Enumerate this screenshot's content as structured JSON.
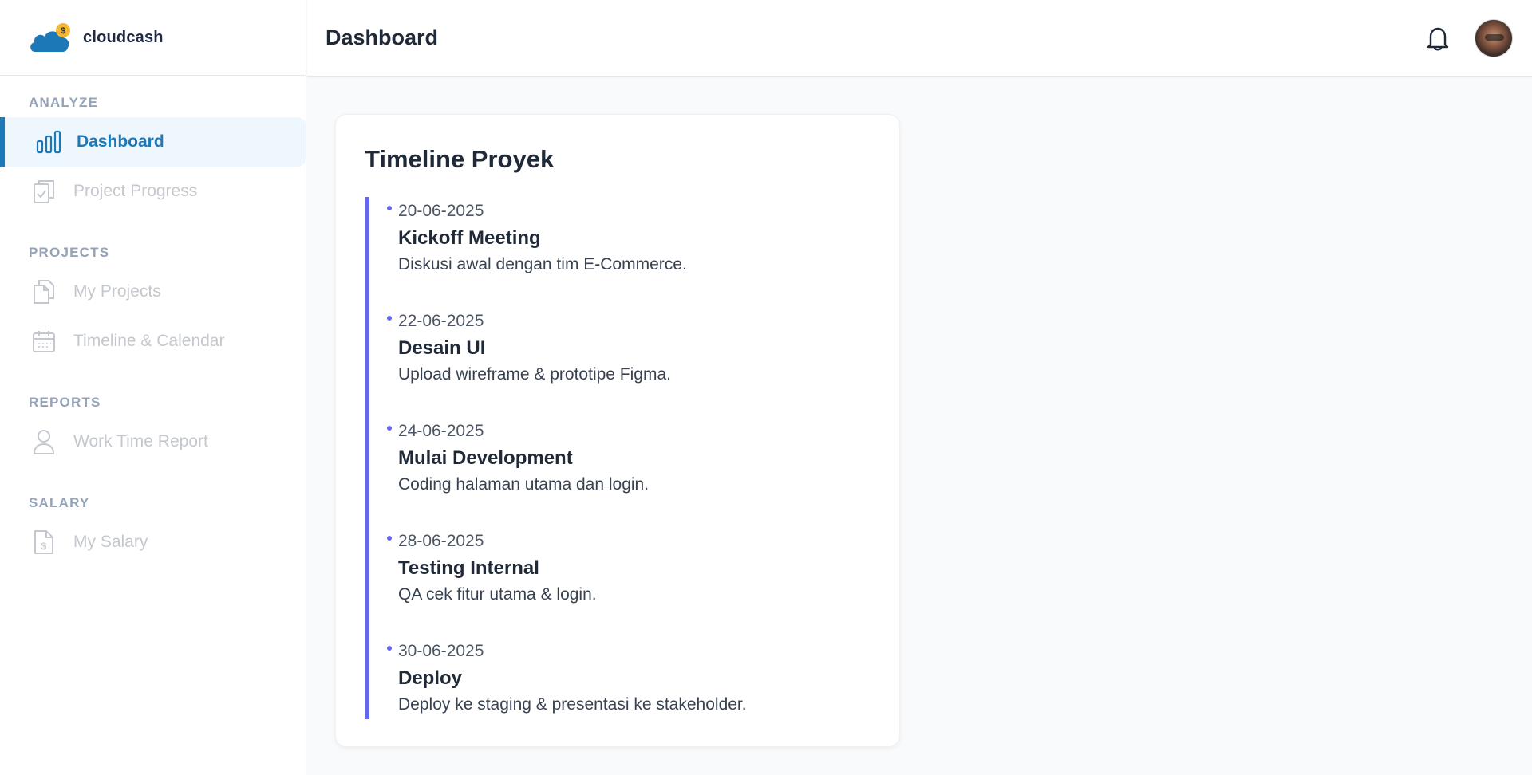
{
  "brand": {
    "name": "cloudcash"
  },
  "header": {
    "title": "Dashboard"
  },
  "sidebar": {
    "sections": [
      {
        "label": "ANALYZE"
      },
      {
        "label": "PROJECTS"
      },
      {
        "label": "REPORTS"
      },
      {
        "label": "SALARY"
      }
    ],
    "items": [
      {
        "label": "Dashboard",
        "icon": "bar-chart-icon",
        "active": true
      },
      {
        "label": "Project Progress",
        "icon": "clipboard-check-icon"
      },
      {
        "label": "My Projects",
        "icon": "documents-icon"
      },
      {
        "label": "Timeline & Calendar",
        "icon": "calendar-icon"
      },
      {
        "label": "Work Time Report",
        "icon": "user-icon"
      },
      {
        "label": "My Salary",
        "icon": "salary-document-icon"
      }
    ]
  },
  "card": {
    "title": "Timeline Proyek",
    "events": [
      {
        "date": "20-06-2025",
        "title": "Kickoff Meeting",
        "desc": "Diskusi awal dengan tim E-Commerce."
      },
      {
        "date": "22-06-2025",
        "title": "Desain UI",
        "desc": "Upload wireframe & prototipe Figma."
      },
      {
        "date": "24-06-2025",
        "title": "Mulai Development",
        "desc": "Coding halaman utama dan login."
      },
      {
        "date": "28-06-2025",
        "title": "Testing Internal",
        "desc": "QA cek fitur utama & login."
      },
      {
        "date": "30-06-2025",
        "title": "Deploy",
        "desc": "Deploy ke staging & presentasi ke stakeholder."
      }
    ]
  },
  "colors": {
    "accent": "#1d78b8",
    "timeline": "#6366f1",
    "muted_nav": "#c4c8ce",
    "section_label": "#94a3b8"
  }
}
